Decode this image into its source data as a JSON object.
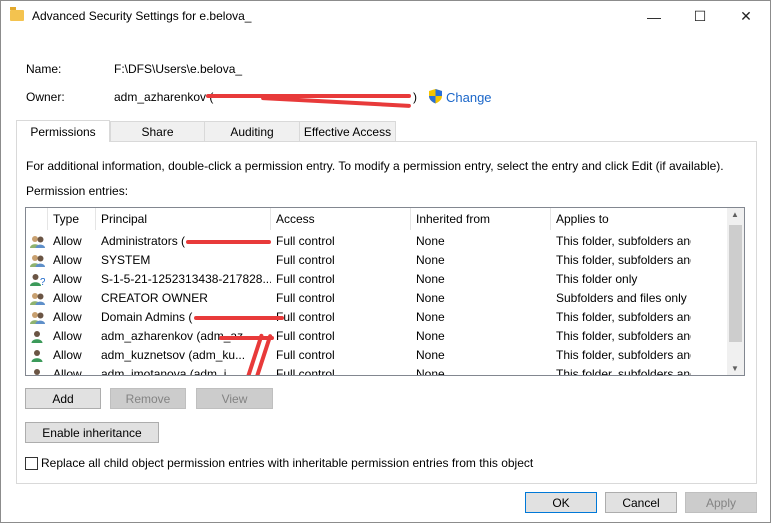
{
  "window": {
    "title": "Advanced Security Settings for e.belova_",
    "minimize": "—",
    "maximize": "☐",
    "close": "✕"
  },
  "name_label": "Name:",
  "name_value": "F:\\DFS\\Users\\e.belova_",
  "owner_label": "Owner:",
  "owner_value": "adm_azharenkov (",
  "owner_close": ")",
  "change_link": "Change",
  "tabs": [
    {
      "label": "Permissions"
    },
    {
      "label": "Share"
    },
    {
      "label": "Auditing"
    },
    {
      "label": "Effective Access"
    }
  ],
  "info_text": "For additional information, double-click a permission entry. To modify a permission entry, select the entry and click Edit (if available).",
  "entries_label": "Permission entries:",
  "columns": [
    "Type",
    "Principal",
    "Access",
    "Inherited from",
    "Applies to"
  ],
  "rows": [
    {
      "icon": "group-icon",
      "type": "Allow",
      "principal": "Administrators (",
      "access": "Full control",
      "inherited": "None",
      "applies": "This folder, subfolders and files"
    },
    {
      "icon": "group-icon",
      "type": "Allow",
      "principal": "SYSTEM",
      "access": "Full control",
      "inherited": "None",
      "applies": "This folder, subfolders and files"
    },
    {
      "icon": "unknown-user-icon",
      "type": "Allow",
      "principal": "S-1-5-21-1252313438-217828...",
      "access": "Full control",
      "inherited": "None",
      "applies": "This folder only"
    },
    {
      "icon": "group-icon",
      "type": "Allow",
      "principal": "CREATOR OWNER",
      "access": "Full control",
      "inherited": "None",
      "applies": "Subfolders and files only"
    },
    {
      "icon": "group-icon",
      "type": "Allow",
      "principal": "Domain Admins (",
      "access": "Full control",
      "inherited": "None",
      "applies": "This folder, subfolders and files"
    },
    {
      "icon": "user-icon",
      "type": "Allow",
      "principal": "adm_azharenkov (adm_az",
      "access": "Full control",
      "inherited": "None",
      "applies": "This folder, subfolders and files"
    },
    {
      "icon": "user-icon",
      "type": "Allow",
      "principal": "adm_kuznetsov (adm_ku...",
      "access": "Full control",
      "inherited": "None",
      "applies": "This folder, subfolders and files"
    },
    {
      "icon": "user-icon",
      "type": "Allow",
      "principal": "adm_imotanova (adm_i...",
      "access": "Full control",
      "inherited": "None",
      "applies": "This folder, subfolders and files"
    }
  ],
  "buttons": {
    "add": "Add",
    "remove": "Remove",
    "view": "View",
    "enable_inheritance": "Enable inheritance",
    "ok": "OK",
    "cancel": "Cancel",
    "apply": "Apply"
  },
  "replace_checkbox": {
    "label": "Replace all child object permission entries with inheritable permission entries from this object",
    "checked": false
  },
  "colors": {
    "accent": "#0078d7",
    "link": "#1a66c9",
    "redaction": "#e83a3a"
  }
}
